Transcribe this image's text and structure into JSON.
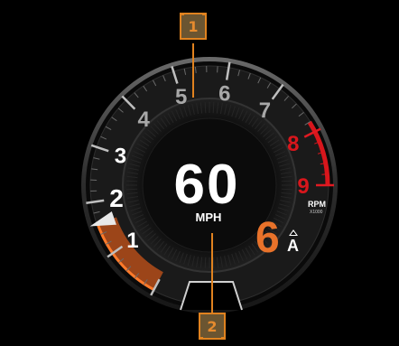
{
  "gauge": {
    "speed_value": "60",
    "speed_unit": "MPH",
    "gear": "6",
    "gear_mode": "A",
    "rpm_label": "RPM",
    "rpm_multiplier": "X1000",
    "rpm_needle_level": 1.6,
    "scale_labels": [
      "1",
      "2",
      "3",
      "4",
      "5",
      "6",
      "7",
      "8",
      "9"
    ],
    "redline_from": 8
  },
  "callouts": [
    {
      "label": "1"
    },
    {
      "label": "2"
    }
  ],
  "colors": {
    "accent_orange": "#e8722a",
    "callout_fill": "#6b5531",
    "callout_border": "#e0821f",
    "redline": "#d8161c",
    "scale_normal": "#b8b8b8"
  }
}
